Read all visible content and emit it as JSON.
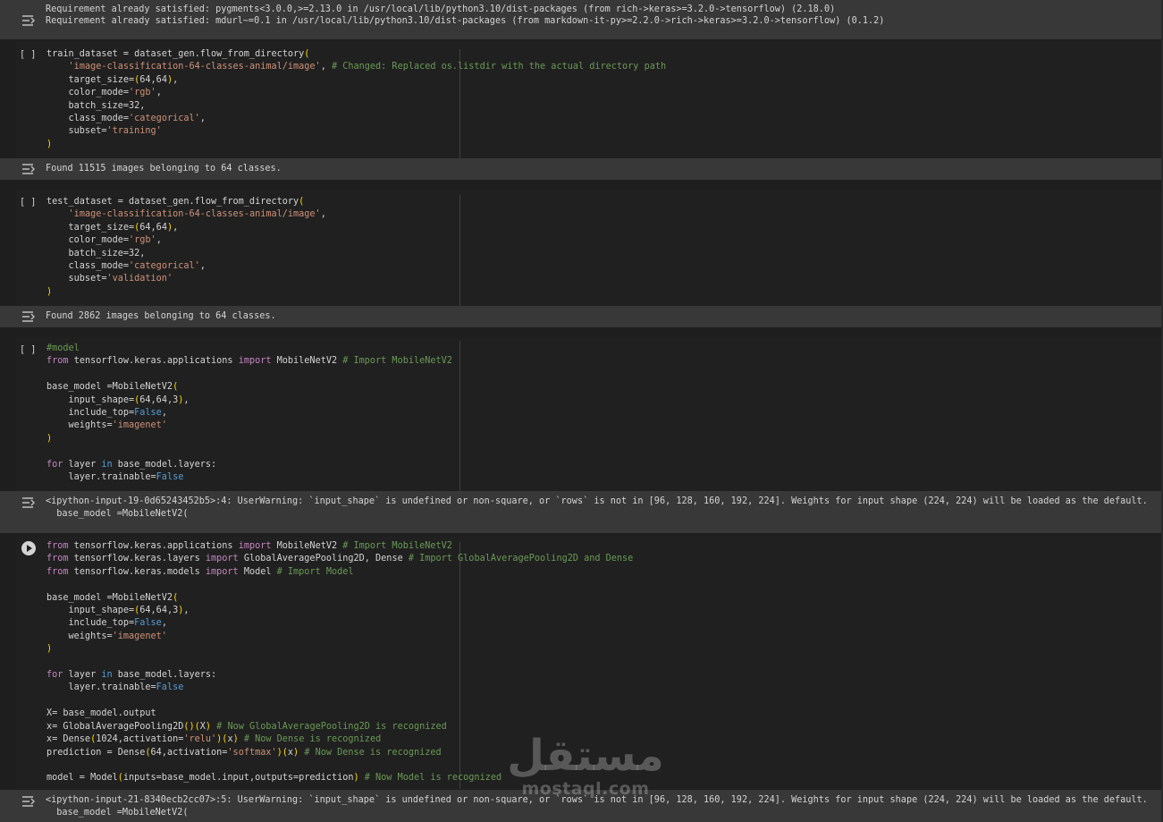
{
  "cells": {
    "out0": {
      "lines": [
        "Requirement already satisfied: pygments<3.0.0,>=2.13.0 in /usr/local/lib/python3.10/dist-packages (from rich->keras>=3.2.0->tensorflow) (2.18.0)",
        "Requirement already satisfied: mdurl~=0.1 in /usr/local/lib/python3.10/dist-packages (from markdown-it-py>=2.2.0->rich->keras>=3.2.0->tensorflow) (0.1.2)"
      ]
    },
    "cell1": {
      "button": "[ ]",
      "output": "Found 11515 images belonging to 64 classes."
    },
    "cell2": {
      "button": "[ ]",
      "output": "Found 2862 images belonging to 64 classes."
    },
    "cell3": {
      "button": "[ ]",
      "output_lines": [
        "<ipython-input-19-0d65243452b5>:4: UserWarning: `input_shape` is undefined or non-square, or `rows` is not in [96, 128, 160, 192, 224]. Weights for input shape (224, 224) will be loaded as the default.",
        "  base_model =MobileNetV2("
      ]
    },
    "cell4": {
      "output_lines": [
        "<ipython-input-21-8340ecb2cc07>:5: UserWarning: `input_shape` is undefined or non-square, or `rows` is not in [96, 128, 160, 192, 224]. Weights for input shape (224, 224) will be loaded as the default.",
        "  base_model =MobileNetV2("
      ]
    }
  },
  "watermark": {
    "arabic": "مستقل",
    "latin": "mostaql.com"
  },
  "icons": {
    "output": "output-toggle-icon",
    "run": "run-cell-icon"
  },
  "colors": {
    "keyword": "#c586c0",
    "builtin": "#569cd6",
    "string": "#ce9178",
    "comment": "#6a9955",
    "number": "#b5cea8",
    "bracket": "#ffd700"
  }
}
